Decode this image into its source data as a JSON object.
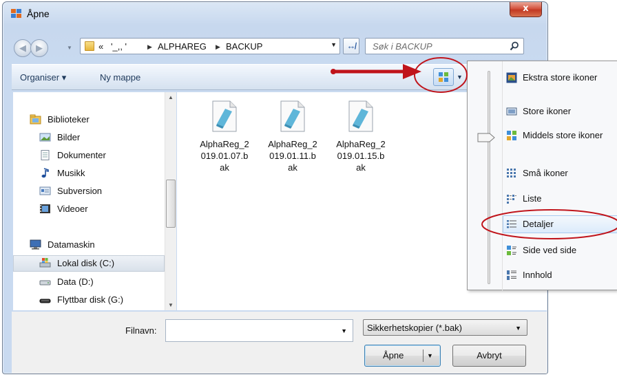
{
  "window": {
    "title": "Åpne",
    "close_label": "x"
  },
  "address": {
    "overflow": "«",
    "crumb_hidden": "'_,, '",
    "crumbs": [
      "ALPHAREG",
      "BACKUP"
    ],
    "sep": "▶"
  },
  "search": {
    "placeholder": "Søk i BACKUP"
  },
  "toolbar": {
    "organize": "Organiser ▾",
    "new_folder": "Ny mappe"
  },
  "navigation": {
    "libraries": "Biblioteker",
    "library_items": [
      "Bilder",
      "Dokumenter",
      "Musikk",
      "Subversion",
      "Videoer"
    ],
    "computer": "Datamaskin",
    "drives": [
      "Lokal disk (C:)",
      "Data (D:)",
      "Flyttbar disk (G:)"
    ]
  },
  "files": [
    {
      "name_lines": [
        "AlphaReg_2",
        "019.01.07.b",
        "ak"
      ]
    },
    {
      "name_lines": [
        "AlphaReg_2",
        "019.01.11.b",
        "ak"
      ]
    },
    {
      "name_lines": [
        "AlphaReg_2",
        "019.01.15.b",
        "ak"
      ]
    }
  ],
  "bottom": {
    "filename_label": "Filnavn:",
    "filename_value": "",
    "filter_value": "Sikkerhetskopier  (*.bak)",
    "open_label": "Åpne",
    "cancel_label": "Avbryt"
  },
  "views_menu": {
    "items": [
      "Ekstra store ikoner",
      "Store ikoner",
      "Middels store ikoner",
      "Små ikoner",
      "Liste",
      "Detaljer",
      "Side ved side",
      "Innhold"
    ],
    "highlighted": "Detaljer"
  },
  "colors": {
    "annotation": "#c0141b",
    "titlebar": "#c7d8ee",
    "close": "#c23a23"
  }
}
